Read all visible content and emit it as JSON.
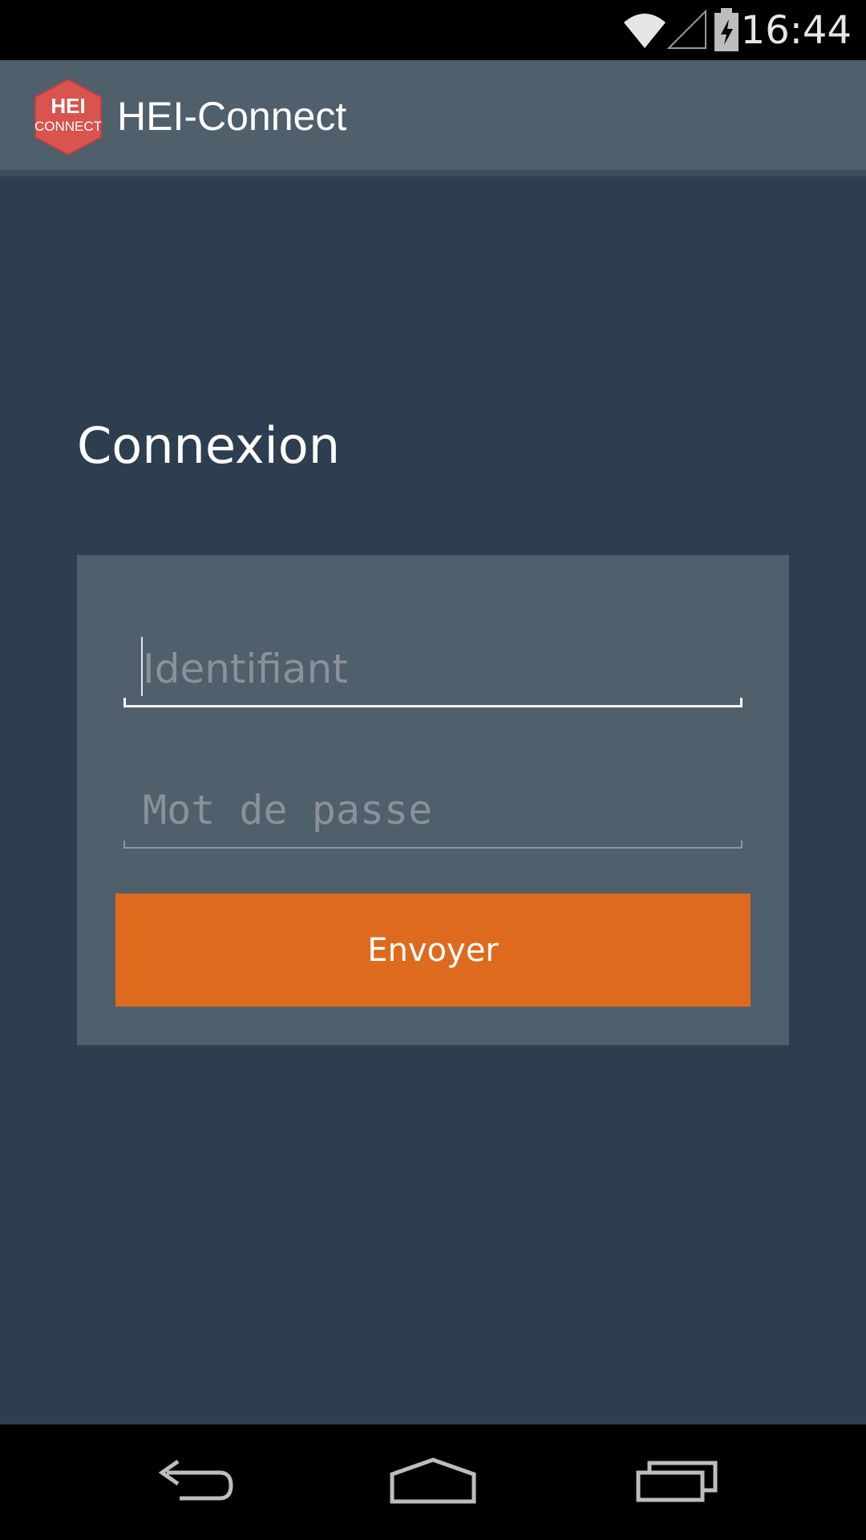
{
  "status_bar": {
    "time": "16:44",
    "icons": [
      "wifi-icon",
      "cell-signal-icon",
      "battery-charging-icon"
    ]
  },
  "action_bar": {
    "logo": {
      "line1": "HEI",
      "line2": "CONNECT",
      "color": "#d9534f"
    },
    "title": "HEI-Connect"
  },
  "login": {
    "heading": "Connexion",
    "username_placeholder": "Identifiant",
    "password_placeholder": "Mot de passe",
    "submit_label": "Envoyer"
  },
  "nav_bar": {
    "icons": [
      "back-icon",
      "home-icon",
      "recents-icon"
    ]
  },
  "colors": {
    "background": "#2d3e50",
    "card": "#4f5f6c",
    "accent": "#de6a1e"
  }
}
